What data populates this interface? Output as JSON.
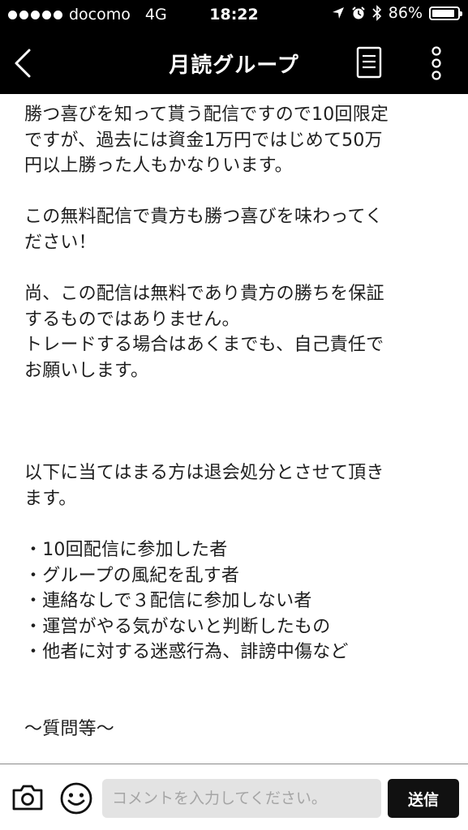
{
  "status_bar": {
    "carrier": "docomo",
    "network": "4G",
    "time": "18:22",
    "battery": "86%",
    "battery_level": 0.86,
    "icons": [
      "signal-dots-icon",
      "location-arrow-icon",
      "alarm-icon",
      "bluetooth-icon",
      "battery-icon"
    ]
  },
  "header": {
    "title": "月読グループ",
    "back_icon": "chevron-left-icon",
    "notes_icon": "notes-icon",
    "more_icon": "more-vertical-icon"
  },
  "message": {
    "text": "勝つ喜びを知って貰う配信ですので10回限定\nですが、過去には資金1万円ではじめて50万\n円以上勝った人もかなりいます。\n\nこの無料配信で貴方も勝つ喜びを味わってく\nださい！\n\n尚、この配信は無料であり貴方の勝ちを保証\nするものではありません。\nトレードする場合はあくまでも、自己責任で\nお願いします。\n\n\n\n以下に当てはまる方は退会処分とさせて頂き\nます。\n\n・10回配信に参加した者\n・グループの風紀を乱す者\n・連絡なしで３配信に参加しない者\n・運営がやる気がないと判断したもの\n・他者に対する迷惑行為、誹謗中傷など\n\n\n〜質問等〜"
  },
  "input_bar": {
    "placeholder": "コメントを入力してください。",
    "value": "",
    "send_label": "送信",
    "camera_icon": "camera-icon",
    "emoji_icon": "emoji-icon"
  },
  "colors": {
    "bar_background": "#000000",
    "input_background": "#e3e3e3",
    "send_button": "#111111"
  }
}
